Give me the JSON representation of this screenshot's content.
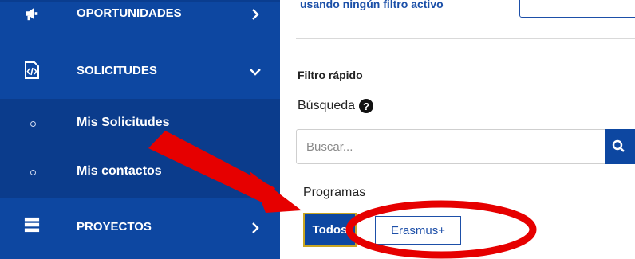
{
  "sidebar": {
    "items": [
      {
        "label": "OPORTUNIDADES",
        "icon": "megaphone-icon",
        "chevron": "chevron-right-icon"
      },
      {
        "label": "SOLICITUDES",
        "icon": "code-file-icon",
        "chevron": "chevron-down-icon"
      },
      {
        "label": "Mis Solicitudes"
      },
      {
        "label": "Mis contactos"
      },
      {
        "label": "PROYECTOS",
        "icon": "server-stack-icon",
        "chevron": "chevron-right-icon"
      }
    ]
  },
  "main": {
    "filter_note": "usando ningún filtro activo",
    "quick_filter_title": "Filtro rápido",
    "search_label": "Búsqueda",
    "search_placeholder": "Buscar...",
    "programs_label": "Programas",
    "program_buttons": [
      "Todos",
      "Erasmus+"
    ]
  },
  "colors": {
    "sidebar_bg": "#0d47a1",
    "subnav_bg": "#0b3c8c",
    "accent_border": "#c9a623",
    "annotation_red": "#e60000"
  }
}
